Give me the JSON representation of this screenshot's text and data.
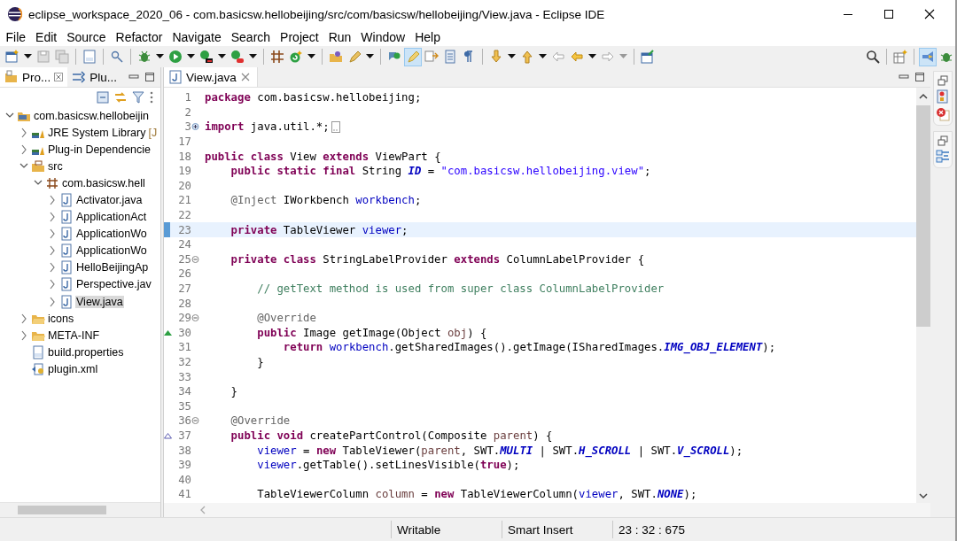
{
  "window": {
    "title": "eclipse_workspace_2020_06 - com.basicsw.hellobeijing/src/com/basicsw/hellobeijing/View.java - Eclipse IDE"
  },
  "menu": [
    "File",
    "Edit",
    "Source",
    "Refactor",
    "Navigate",
    "Search",
    "Project",
    "Run",
    "Window",
    "Help"
  ],
  "toolbar": {
    "highlight_button": {
      "selected": true
    }
  },
  "perspectives": [
    {
      "selected": true
    },
    {
      "selected": false
    }
  ],
  "left_panel": {
    "tabs": [
      {
        "label": "Pro...",
        "selected": true
      },
      {
        "label": "Plu...",
        "selected": false
      }
    ],
    "tree": [
      {
        "label": "com.basicsw.hellobeijin",
        "kind": "project",
        "expanded": true,
        "selected": false,
        "children": [
          {
            "label": "JRE System Library",
            "decoration": "[J",
            "kind": "library",
            "expanded": false,
            "selected": false
          },
          {
            "label": "Plug-in Dependencie",
            "kind": "library",
            "expanded": false,
            "selected": false
          },
          {
            "label": "src",
            "kind": "source",
            "expanded": true,
            "selected": false,
            "children": [
              {
                "label": "com.basicsw.hell",
                "kind": "package",
                "expanded": true,
                "selected": false,
                "children": [
                  {
                    "label": "Activator.java",
                    "kind": "java",
                    "expanded": false,
                    "selected": false
                  },
                  {
                    "label": "ApplicationAct",
                    "kind": "java",
                    "expanded": false,
                    "selected": false
                  },
                  {
                    "label": "ApplicationWo",
                    "kind": "java",
                    "expanded": false,
                    "selected": false
                  },
                  {
                    "label": "ApplicationWo",
                    "kind": "java",
                    "expanded": false,
                    "selected": false
                  },
                  {
                    "label": "HelloBeijingAp",
                    "kind": "java",
                    "expanded": false,
                    "selected": false
                  },
                  {
                    "label": "Perspective.jav",
                    "kind": "java",
                    "expanded": false,
                    "selected": false
                  },
                  {
                    "label": "View.java",
                    "kind": "java",
                    "expanded": false,
                    "selected": true
                  }
                ]
              }
            ]
          },
          {
            "label": "icons",
            "kind": "folder",
            "expanded": false,
            "selected": false
          },
          {
            "label": "META-INF",
            "kind": "folder",
            "expanded": false,
            "selected": false
          },
          {
            "label": "build.properties",
            "kind": "properties",
            "selected": false
          },
          {
            "label": "plugin.xml",
            "kind": "xml",
            "selected": false
          }
        ]
      }
    ]
  },
  "editor": {
    "tabs": [
      {
        "label": "View.java",
        "selected": true
      }
    ],
    "lines": [
      {
        "number": "1",
        "kind": "plain",
        "tokens": [
          {
            "text": "package",
            "kind": "keyword"
          },
          {
            "text": " com.basicsw.hellobeijing;",
            "kind": "plain"
          }
        ]
      },
      {
        "number": "2",
        "kind": "plain"
      },
      {
        "number": "3",
        "kind": "fold-collapsed",
        "folded": true,
        "tokens": [
          {
            "text": "import",
            "kind": "keyword"
          },
          {
            "text": " java.util.*;",
            "kind": "plain"
          }
        ]
      },
      {
        "number": "17",
        "kind": "plain"
      },
      {
        "number": "18",
        "kind": "plain",
        "tokens": [
          {
            "text": "public class",
            "kind": "keyword"
          },
          {
            "text": " View ",
            "kind": "plain"
          },
          {
            "text": "extends",
            "kind": "keyword"
          },
          {
            "text": " ViewPart {",
            "kind": "plain"
          }
        ]
      },
      {
        "number": "19",
        "kind": "plain",
        "tokens": [
          {
            "text": "    public static final",
            "kind": "keyword"
          },
          {
            "text": " String ",
            "kind": "plain"
          },
          {
            "text": "ID",
            "kind": "constant"
          },
          {
            "text": " = ",
            "kind": "plain"
          },
          {
            "text": "\"com.basicsw.hellobeijing.view\"",
            "kind": "string"
          },
          {
            "text": ";",
            "kind": "plain"
          }
        ]
      },
      {
        "number": "20",
        "kind": "plain"
      },
      {
        "number": "21",
        "kind": "plain",
        "tokens": [
          {
            "text": "    @Inject",
            "kind": "annotation"
          },
          {
            "text": " IWorkbench ",
            "kind": "plain"
          },
          {
            "text": "workbench",
            "kind": "field"
          },
          {
            "text": ";",
            "kind": "plain"
          }
        ]
      },
      {
        "number": "22",
        "kind": "plain"
      },
      {
        "number": "23",
        "kind": "plain",
        "current": true,
        "tokens": [
          {
            "text": "    private",
            "kind": "keyword"
          },
          {
            "text": " TableViewer ",
            "kind": "plain"
          },
          {
            "text": "viewer",
            "kind": "field"
          },
          {
            "text": ";",
            "kind": "plain"
          }
        ]
      },
      {
        "number": "24",
        "kind": "plain"
      },
      {
        "number": "25",
        "kind": "fold-expanded",
        "tokens": [
          {
            "text": "    private class",
            "kind": "keyword"
          },
          {
            "text": " StringLabelProvider ",
            "kind": "plain"
          },
          {
            "text": "extends",
            "kind": "keyword"
          },
          {
            "text": " ColumnLabelProvider {",
            "kind": "plain"
          }
        ]
      },
      {
        "number": "26",
        "kind": "plain"
      },
      {
        "number": "27",
        "kind": "plain",
        "tokens": [
          {
            "text": "        // getText method is used from super class ColumnLabelProvider",
            "kind": "comment"
          }
        ]
      },
      {
        "number": "28",
        "kind": "plain"
      },
      {
        "number": "29",
        "kind": "fold-expanded",
        "tokens": [
          {
            "text": "        @Override",
            "kind": "annotation"
          }
        ]
      },
      {
        "number": "30",
        "kind": "override",
        "tokens": [
          {
            "text": "        public",
            "kind": "keyword"
          },
          {
            "text": " Image getImage(Object ",
            "kind": "plain"
          },
          {
            "text": "obj",
            "kind": "parameter"
          },
          {
            "text": ") {",
            "kind": "plain"
          }
        ]
      },
      {
        "number": "31",
        "kind": "plain",
        "tokens": [
          {
            "text": "            return ",
            "kind": "keyword"
          },
          {
            "text": "workbench",
            "kind": "field"
          },
          {
            "text": ".getSharedImages().getImage(ISharedImages.",
            "kind": "plain"
          },
          {
            "text": "IMG_OBJ_ELEMENT",
            "kind": "constant"
          },
          {
            "text": ");",
            "kind": "plain"
          }
        ]
      },
      {
        "number": "32",
        "kind": "plain",
        "tokens": [
          {
            "text": "        }",
            "kind": "plain"
          }
        ]
      },
      {
        "number": "33",
        "kind": "plain"
      },
      {
        "number": "34",
        "kind": "plain",
        "tokens": [
          {
            "text": "    }",
            "kind": "plain"
          }
        ]
      },
      {
        "number": "35",
        "kind": "plain"
      },
      {
        "number": "36",
        "kind": "fold-expanded",
        "tokens": [
          {
            "text": "    @Override",
            "kind": "annotation"
          }
        ]
      },
      {
        "number": "37",
        "kind": "implements",
        "tokens": [
          {
            "text": "    public void",
            "kind": "keyword"
          },
          {
            "text": " createPartControl(Composite ",
            "kind": "plain"
          },
          {
            "text": "parent",
            "kind": "parameter"
          },
          {
            "text": ") {",
            "kind": "plain"
          }
        ]
      },
      {
        "number": "38",
        "kind": "plain",
        "tokens": [
          {
            "text": "        viewer",
            "kind": "field"
          },
          {
            "text": " = ",
            "kind": "plain"
          },
          {
            "text": "new",
            "kind": "keyword"
          },
          {
            "text": " TableViewer(",
            "kind": "plain"
          },
          {
            "text": "parent",
            "kind": "parameter"
          },
          {
            "text": ", SWT.",
            "kind": "plain"
          },
          {
            "text": "MULTI",
            "kind": "constant"
          },
          {
            "text": " | SWT.",
            "kind": "plain"
          },
          {
            "text": "H_SCROLL",
            "kind": "constant"
          },
          {
            "text": " | SWT.",
            "kind": "plain"
          },
          {
            "text": "V_SCROLL",
            "kind": "constant"
          },
          {
            "text": ");",
            "kind": "plain"
          }
        ]
      },
      {
        "number": "39",
        "kind": "plain",
        "tokens": [
          {
            "text": "        viewer",
            "kind": "field"
          },
          {
            "text": ".getTable().setLinesVisible(",
            "kind": "plain"
          },
          {
            "text": "true",
            "kind": "keyword"
          },
          {
            "text": ");",
            "kind": "plain"
          }
        ]
      },
      {
        "number": "40",
        "kind": "plain"
      },
      {
        "number": "41",
        "kind": "plain",
        "tokens": [
          {
            "text": "        TableViewerColumn ",
            "kind": "plain"
          },
          {
            "text": "column",
            "kind": "parameter"
          },
          {
            "text": " = ",
            "kind": "plain"
          },
          {
            "text": "new",
            "kind": "keyword"
          },
          {
            "text": " TableViewerColumn(",
            "kind": "plain"
          },
          {
            "text": "viewer",
            "kind": "field"
          },
          {
            "text": ", SWT.",
            "kind": "plain"
          },
          {
            "text": "NONE",
            "kind": "constant"
          },
          {
            "text": ");",
            "kind": "plain"
          }
        ]
      }
    ]
  },
  "status_bar": {
    "fields": [
      "Writable",
      "Smart Insert",
      "23 : 32 : 675"
    ]
  }
}
